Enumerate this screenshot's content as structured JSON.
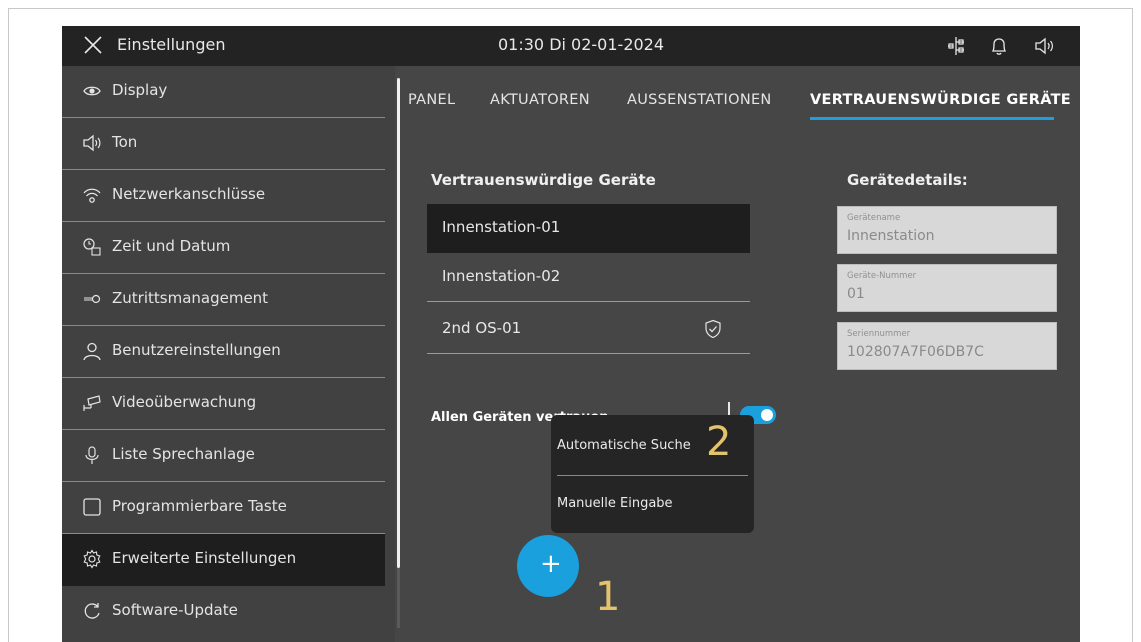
{
  "topbar": {
    "title": "Einstellungen",
    "clock": "01:30  Di 02-01-2024",
    "icons": [
      "close-icon",
      "network-icon",
      "bell-icon",
      "speaker-icon"
    ]
  },
  "sidebar": {
    "items": [
      {
        "label": "Display",
        "icon": "eye-icon"
      },
      {
        "label": "Ton",
        "icon": "speaker-icon"
      },
      {
        "label": "Netzwerkanschlüsse",
        "icon": "wifi-icon"
      },
      {
        "label": "Zeit und Datum",
        "icon": "clock-calendar-icon"
      },
      {
        "label": "Zutrittsmanagement",
        "icon": "key-icon"
      },
      {
        "label": "Benutzereinstellungen",
        "icon": "user-icon"
      },
      {
        "label": "Videoüberwachung",
        "icon": "camera-icon"
      },
      {
        "label": "Liste Sprechanlage",
        "icon": "microphone-icon"
      },
      {
        "label": "Programmierbare Taste",
        "icon": "square-icon"
      },
      {
        "label": "Erweiterte Einstellungen",
        "icon": "gear-icon",
        "active": true
      },
      {
        "label": "Software-Update",
        "icon": "refresh-icon"
      }
    ]
  },
  "tabs": [
    {
      "label": "PANEL"
    },
    {
      "label": "AKTUATOREN"
    },
    {
      "label": "AUSSENSTATIONEN"
    },
    {
      "label": "VERTRAUENSWÜRDIGE GERÄTE",
      "active": true
    }
  ],
  "trusted": {
    "title": "Vertrauenswürdige Geräte",
    "devices": [
      {
        "name": "Innenstation-01",
        "selected": true
      },
      {
        "name": "Innenstation-02"
      },
      {
        "name": "2nd OS-01",
        "icon": "shield-check-icon"
      }
    ],
    "trust_all_label": "Allen Geräten vertrauen",
    "trust_all_on": true
  },
  "details": {
    "title": "Gerätedetails:",
    "fields": [
      {
        "label": "Gerätename",
        "value": "Innenstation"
      },
      {
        "label": "Geräte-Nummer",
        "value": "01"
      },
      {
        "label": "Seriennummer",
        "value": "102807A7F06DB7C"
      }
    ]
  },
  "popup": {
    "items": [
      "Automatische Suche",
      "Manuelle Eingabe"
    ]
  },
  "fab": {
    "symbol": "+"
  },
  "callouts": [
    "1",
    "2"
  ],
  "colors": {
    "accent": "#1aa0dd",
    "callout": "#e3c36b",
    "background": "#464646",
    "topbar": "#232323"
  }
}
